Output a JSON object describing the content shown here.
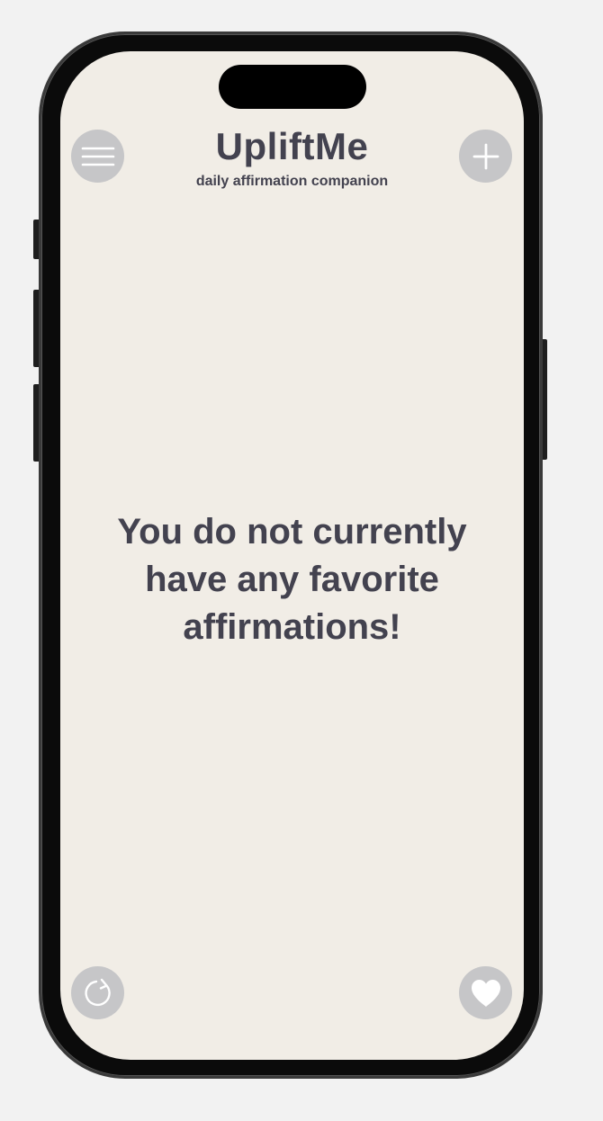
{
  "header": {
    "title": "UpliftMe",
    "subtitle": "daily affirmation companion"
  },
  "main": {
    "empty_message": "You do not currently have any favorite affirmations!"
  },
  "icons": {
    "menu": "hamburger-menu-icon",
    "add": "plus-icon",
    "refresh": "refresh-icon",
    "favorite": "heart-icon"
  },
  "colors": {
    "screen_background": "#f1ede6",
    "text": "#43424f",
    "button_background": "#c6c6c8",
    "icon": "#ffffff"
  }
}
